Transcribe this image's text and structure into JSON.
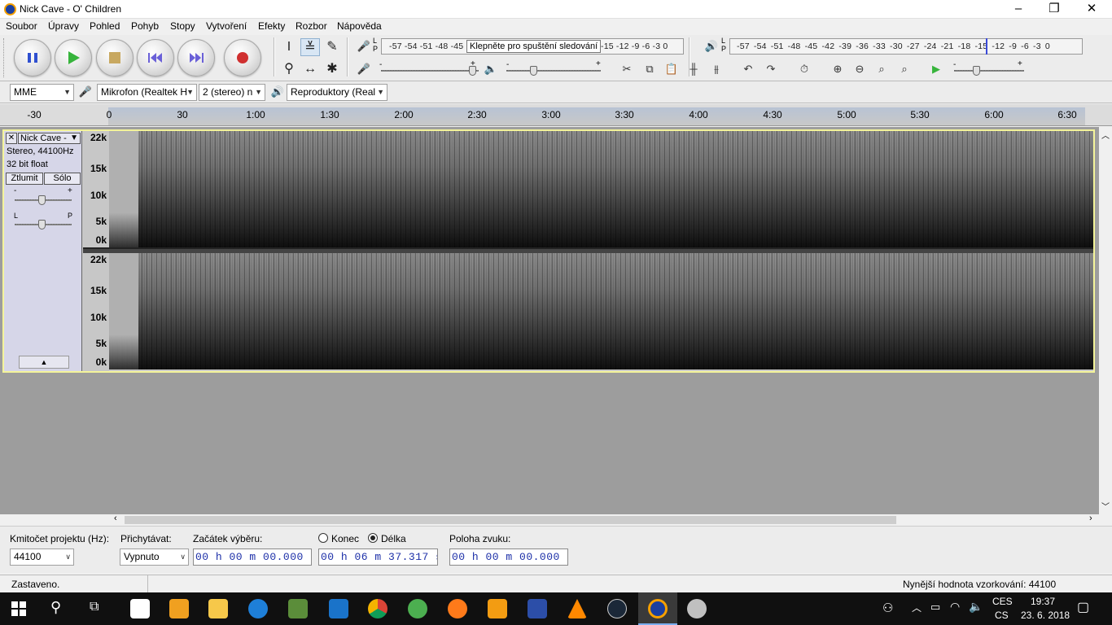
{
  "window": {
    "title": "Nick Cave - O' Children",
    "minimize_glyph": "–",
    "restore_glyph": "❐",
    "close_glyph": "✕"
  },
  "menu": [
    "Soubor",
    "Úpravy",
    "Pohled",
    "Pohyb",
    "Stopy",
    "Vytvoření",
    "Efekty",
    "Rozbor",
    "Nápověda"
  ],
  "meters": {
    "record_scale": "-57 -54 -51 -48 -45",
    "record_tooltip": "Klepněte pro spuštění sledování",
    "record_scale_tail": "-15 -12 -9 -6 -3 0",
    "playback_scale": "-57 -54 -51 -48 -45 -42 -39 -36 -33 -30 -27 -24 -21 -18 -15 -12 -9 -6 -3 0",
    "lr_label": "L\nP",
    "minus": "-",
    "plus": "+"
  },
  "devices": {
    "host": "MME",
    "recording_device": "Mikrofon (Realtek H",
    "channels": "2 (stereo) n",
    "playback_device": "Reproduktory (Real"
  },
  "ruler": {
    "labels": [
      "-30",
      "0",
      "30",
      "1:00",
      "1:30",
      "2:00",
      "2:30",
      "3:00",
      "3:30",
      "4:00",
      "4:30",
      "5:00",
      "5:30",
      "6:00",
      "6:30"
    ]
  },
  "track": {
    "name": "Nick Cave -",
    "close_glyph": "✕",
    "menu_glyph": "▼",
    "format": "Stereo, 44100Hz",
    "bit_depth": "32 bit float",
    "mute_label": "Ztlumit",
    "solo_label": "Sólo",
    "gain_minus": "-",
    "gain_plus": "+",
    "pan_left": "L",
    "pan_right": "P",
    "collapse_glyph": "▲",
    "freq_labels": [
      "22k",
      "15k",
      "10k",
      "5k",
      "0k"
    ]
  },
  "selection": {
    "rate_label": "Kmitočet projektu (Hz):",
    "rate_value": "44100",
    "snap_label": "Přichytávat:",
    "snap_value": "Vypnuto",
    "start_label": "Začátek výběru:",
    "start_value": "00 h 00 m 00.000 s",
    "end_option": "Konec",
    "length_option": "Délka",
    "length_value": "00 h 06 m 37.317 s",
    "position_label": "Poloha zvuku:",
    "position_value": "00 h 00 m 00.000 s"
  },
  "status": {
    "left": "Zastaveno.",
    "right": "Nynější hodnota vzorkování: 44100"
  },
  "taskbar": {
    "language_top": "CES",
    "language_bottom": "CS",
    "time": "19:37",
    "date": "23. 6. 2018"
  }
}
